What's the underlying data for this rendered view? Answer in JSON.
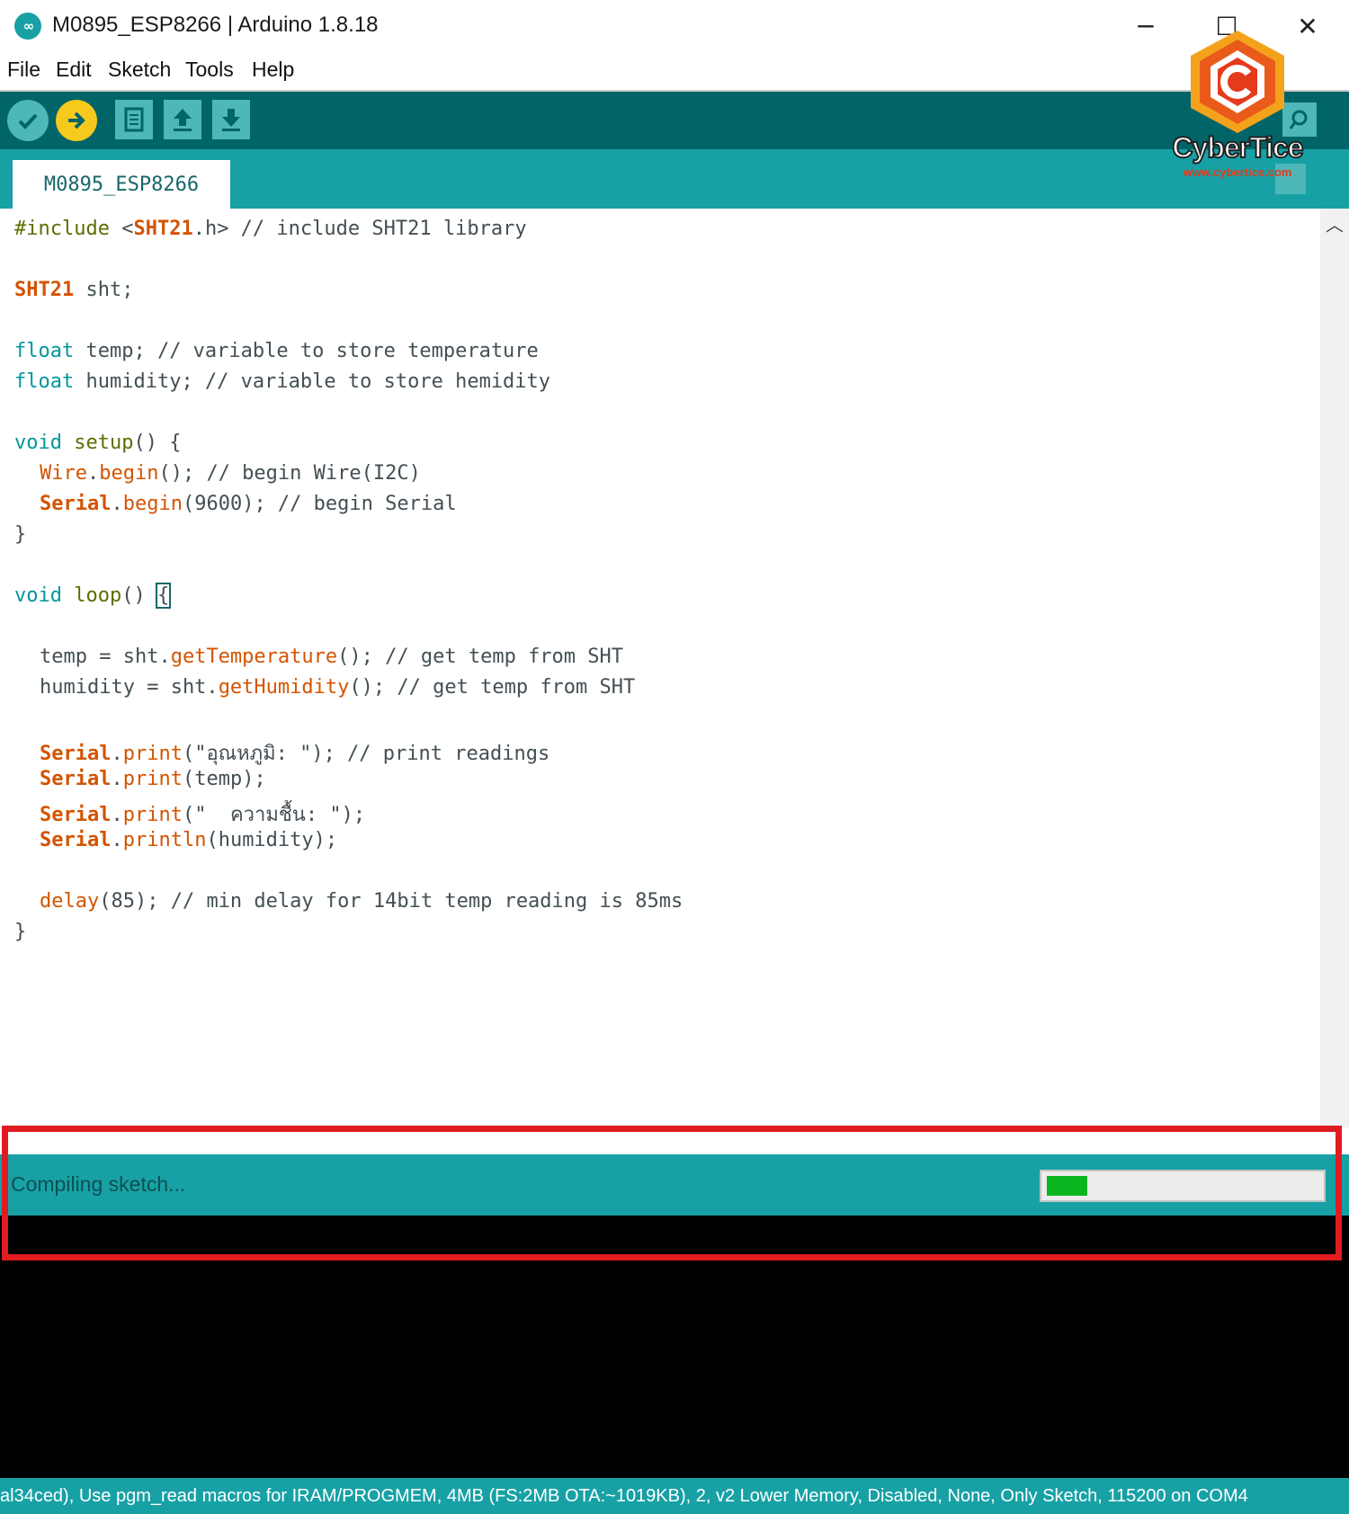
{
  "window": {
    "title": "M0895_ESP8266 | Arduino 1.8.18",
    "app_icon": "infinity-icon",
    "controls": {
      "minimize": "─",
      "maximize": "☐",
      "close": "✕"
    }
  },
  "menu": [
    "File",
    "Edit",
    "Sketch",
    "Tools",
    "Help"
  ],
  "toolbar": {
    "buttons": [
      "verify-icon",
      "upload-icon",
      "new-icon",
      "open-icon",
      "save-icon",
      "serial-monitor-icon"
    ]
  },
  "tab": {
    "label": "M0895_ESP8266"
  },
  "code": {
    "l1_a": "#include",
    "l1_b": " <",
    "l1_c": "SHT21",
    "l1_d": ".h> // include SHT21 library",
    "l3_a": "SHT21",
    "l3_b": " sht;",
    "l5_a": "float",
    "l5_b": " temp; // variable to store temperature",
    "l6_a": "float",
    "l6_b": " humidity; // variable to store hemidity",
    "l8_a": "void",
    "l8_b": " setup",
    "l8_c": "() {",
    "l9_a": "Wire",
    "l9_b": ".",
    "l9_c": "begin",
    "l9_d": "(); // begin Wire(I2C)",
    "l10_a": "Serial",
    "l10_b": ".",
    "l10_c": "begin",
    "l10_d": "(9600); // begin Serial",
    "l11": "}",
    "l13_a": "void",
    "l13_b": " loop",
    "l13_c": "() ",
    "l13_d": "{",
    "l15_a": "temp = sht.",
    "l15_b": "getTemperature",
    "l15_c": "(); // get temp from SHT",
    "l16_a": "humidity = sht.",
    "l16_b": "getHumidity",
    "l16_c": "(); // get temp from SHT",
    "l18_a": "Serial",
    "l18_b": ".",
    "l18_c": "print",
    "l18_d": "(\"อุณหภูมิ: \"); // print readings",
    "l19_a": "Serial",
    "l19_b": ".",
    "l19_c": "print",
    "l19_d": "(temp);",
    "l20_a": "Serial",
    "l20_b": ".",
    "l20_c": "print",
    "l20_d": "(\"  ความชื้น: \");",
    "l21_a": "Serial",
    "l21_b": ".",
    "l21_c": "println",
    "l21_d": "(humidity);",
    "l23_a": "delay",
    "l23_b": "(85); // min delay for 14bit temp reading is 85ms",
    "l24": "}"
  },
  "status": {
    "message": "Compiling sketch...",
    "progress_percent": 15
  },
  "board_info": "al34ced), Use pgm_read macros for IRAM/PROGMEM, 4MB (FS:2MB OTA:~1019KB), 2, v2 Lower Memory, Disabled, None, Only Sketch, 115200 on COM4",
  "watermark": {
    "brand": "CyberTice",
    "url": "www.cybertice.com"
  },
  "colors": {
    "toolbar": "#006468",
    "tabstrip": "#17a1a5",
    "keyword": "#00979d",
    "function": "#d35400",
    "highlight_box": "#e11b22",
    "progress_fill": "#0bb51f"
  }
}
